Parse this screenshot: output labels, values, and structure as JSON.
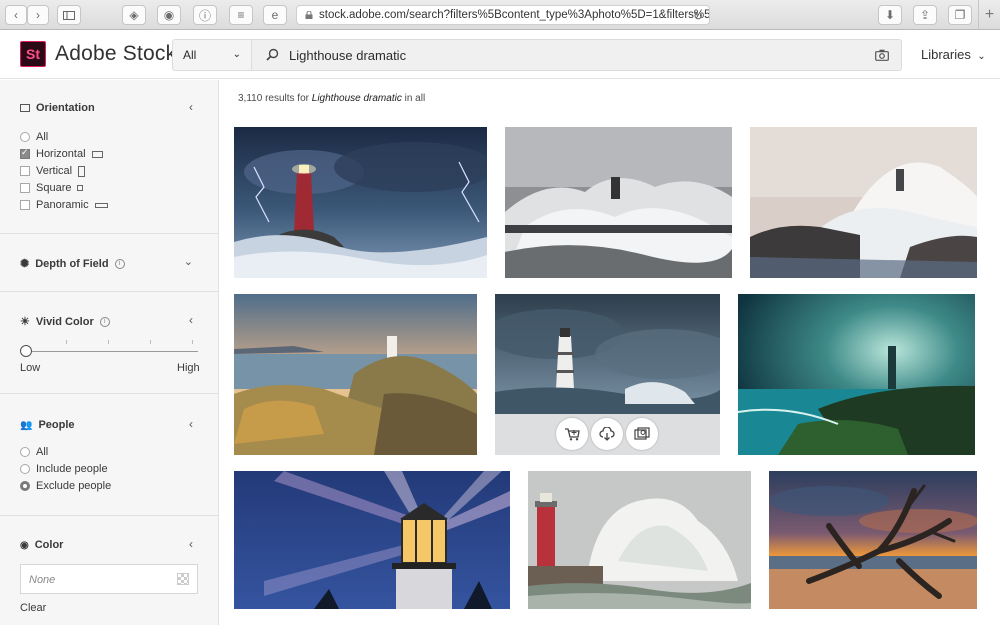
{
  "browser": {
    "url": "stock.adobe.com/search?filters%5Bcontent_type%3Aphoto%5D=1&filters%5Bc"
  },
  "header": {
    "logo_text": "St",
    "brand": "Adobe Stock",
    "filter_value": "All",
    "search_query": "Lighthouse dramatic",
    "libraries_label": "Libraries"
  },
  "sidebar": {
    "orientation": {
      "title": "Orientation",
      "options": [
        "All",
        "Horizontal",
        "Vertical",
        "Square",
        "Panoramic"
      ],
      "checked": "Horizontal"
    },
    "depth_of_field": {
      "title": "Depth of Field"
    },
    "vivid_color": {
      "title": "Vivid Color",
      "low_label": "Low",
      "high_label": "High",
      "level": 0
    },
    "people": {
      "title": "People",
      "options": [
        "All",
        "Include people",
        "Exclude people"
      ],
      "selected": "Exclude people"
    },
    "color": {
      "title": "Color",
      "placeholder": "None",
      "clear_label": "Clear"
    }
  },
  "results": {
    "count": "3,110",
    "results_for": "results for",
    "query": "Lighthouse dramatic",
    "scope": "in all"
  },
  "colors": {
    "logo_border": "#da1f5a",
    "logo_text": "#ff4f8a",
    "sidebar_bg": "#f6f6f6"
  },
  "icons": {
    "hover_actions": [
      "cart-add-icon",
      "cloud-download-icon",
      "find-similar-icon"
    ]
  }
}
